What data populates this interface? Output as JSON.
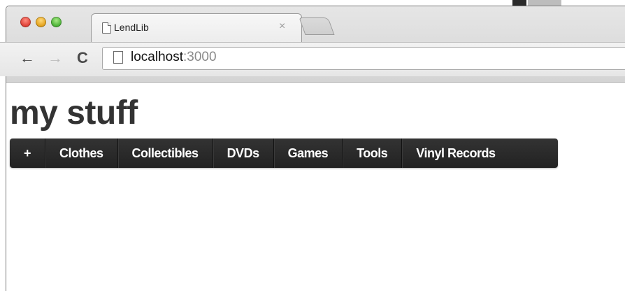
{
  "browser": {
    "tab_title": "LendLib",
    "tab_close": "×",
    "url_host": "localhost",
    "url_port": ":3000",
    "icons": [
      "back-arrow-icon",
      "forward-arrow-icon",
      "reload-icon",
      "page-icon"
    ]
  },
  "page": {
    "heading": "my stuff"
  },
  "nav": {
    "items": [
      {
        "label": "+"
      },
      {
        "label": "Clothes"
      },
      {
        "label": "Collectibles"
      },
      {
        "label": "DVDs"
      },
      {
        "label": "Games"
      },
      {
        "label": "Tools"
      },
      {
        "label": "Vinyl Records"
      }
    ]
  },
  "colors": {
    "navbar": "#2b2b2b",
    "heading": "#333333",
    "nav_text": "#ffffff"
  }
}
